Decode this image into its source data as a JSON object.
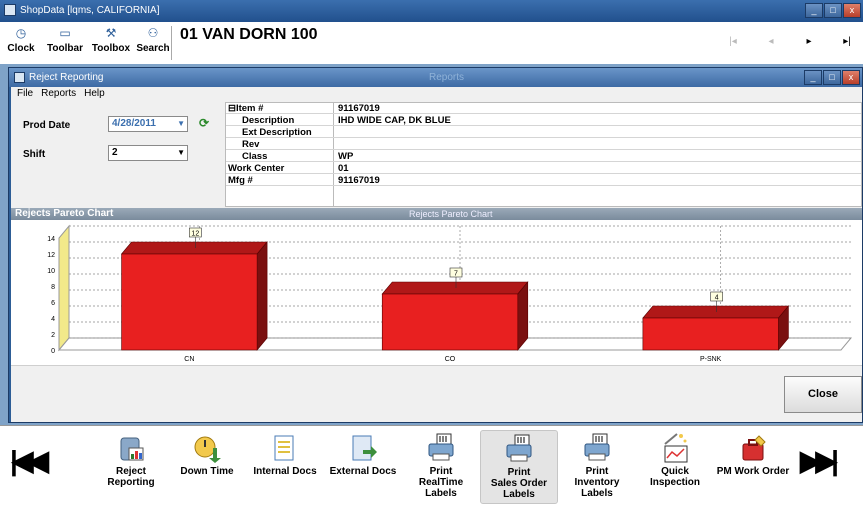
{
  "app": {
    "title": "ShopData [lqms, CALIFORNIA]",
    "window_buttons": [
      "_",
      "□",
      "x"
    ]
  },
  "toolbar": {
    "tools": [
      {
        "label": "Clock",
        "icon": "clock-icon"
      },
      {
        "label": "Toolbar",
        "icon": "toolbar-icon"
      },
      {
        "label": "Toolbox",
        "icon": "toolbox-icon"
      },
      {
        "label": "Search",
        "icon": "binoculars-icon"
      }
    ],
    "header_title": "01  VAN DORN 100",
    "nav_icons": [
      "first-icon",
      "previous-icon",
      "next-icon",
      "last-icon"
    ]
  },
  "window": {
    "title": "Reject Reporting",
    "center_title": "Reports",
    "menu": [
      "File",
      "Reports",
      "Help"
    ]
  },
  "filters": {
    "prod_date_label": "Prod Date",
    "prod_date_value": "4/28/2011",
    "shift_label": "Shift",
    "shift_value": "2"
  },
  "item": {
    "rows": [
      {
        "key": "⊟Item #",
        "value": "91167019"
      },
      {
        "key": "Description",
        "value": "IHD WIDE CAP,  DK BLUE"
      },
      {
        "key": "Ext Description",
        "value": ""
      },
      {
        "key": "Rev",
        "value": ""
      },
      {
        "key": "Class",
        "value": "WP"
      },
      {
        "key": "Work Center",
        "value": "01"
      },
      {
        "key": "Mfg #",
        "value": "91167019"
      }
    ]
  },
  "chart_header": {
    "title": "Rejects Pareto Chart",
    "subtitle": "Rejects Pareto Chart"
  },
  "chart_data": {
    "type": "bar",
    "title": "Rejects Pareto Chart",
    "categories": [
      "CN",
      "CO",
      "P-SNK"
    ],
    "values": [
      12,
      7,
      4
    ],
    "ylim": [
      0,
      14
    ],
    "yticks": [
      0,
      2,
      4,
      6,
      8,
      10,
      12,
      14
    ],
    "xlabel": "",
    "ylabel": "",
    "grid": true,
    "bar_color": "#e82020",
    "style": "3d"
  },
  "close_button": "Close",
  "dock": {
    "items": [
      {
        "label": "Reject\nReporting",
        "icon": "reject-reporting-icon"
      },
      {
        "label": "Down Time",
        "icon": "down-time-icon"
      },
      {
        "label": "Internal Docs",
        "icon": "internal-docs-icon"
      },
      {
        "label": "External Docs",
        "icon": "external-docs-icon"
      },
      {
        "label": "Print\nRealTime\nLabels",
        "icon": "printer-icon"
      },
      {
        "label": "Print\nSales Order\nLabels",
        "icon": "printer-icon"
      },
      {
        "label": "Print\nInventory\nLabels",
        "icon": "printer-icon"
      },
      {
        "label": "Quick\nInspection",
        "icon": "quick-inspection-icon"
      },
      {
        "label": "PM Work Order",
        "icon": "pm-work-order-icon"
      }
    ]
  }
}
